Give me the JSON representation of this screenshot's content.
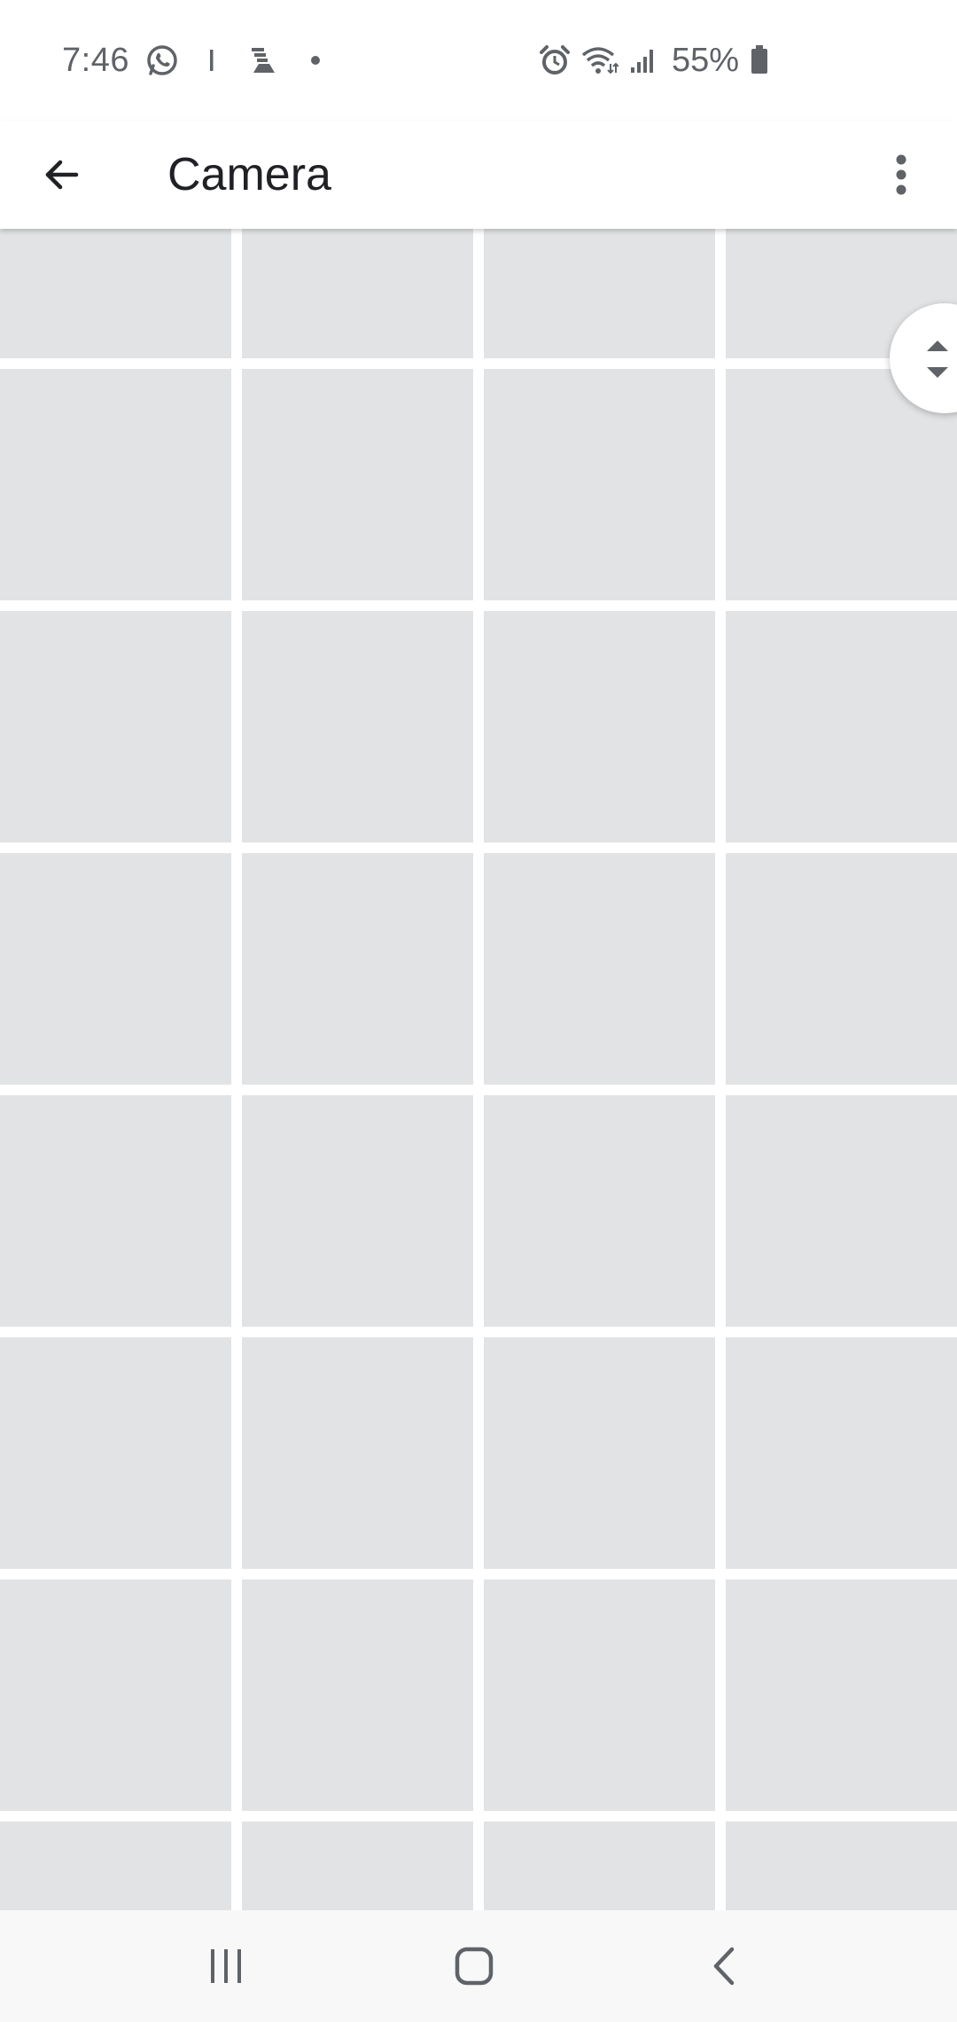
{
  "status_bar": {
    "time": "7:46",
    "battery": "55%",
    "icons": [
      "whatsapp-icon",
      "notification-bar-icon",
      "app-notification-icon",
      "dot-icon",
      "alarm-icon",
      "wifi-icon",
      "signal-icon",
      "battery-icon"
    ]
  },
  "app_bar": {
    "title": "Camera",
    "back_icon": "arrow-back-icon",
    "menu_icon": "more-vert-icon"
  },
  "grid": {
    "columns": 4,
    "tile_color": "#e2e3e5",
    "state": "loading placeholders"
  },
  "fast_scroll": {
    "icon": "up-down-arrows-icon"
  },
  "nav_bar": {
    "buttons": [
      "recent-apps",
      "home",
      "back"
    ]
  },
  "colors": {
    "background": "#ffffff",
    "tile": "#e2e3e5",
    "text_primary": "#202124",
    "status_text": "#5f6368",
    "nav_background": "#f8f8f8"
  }
}
